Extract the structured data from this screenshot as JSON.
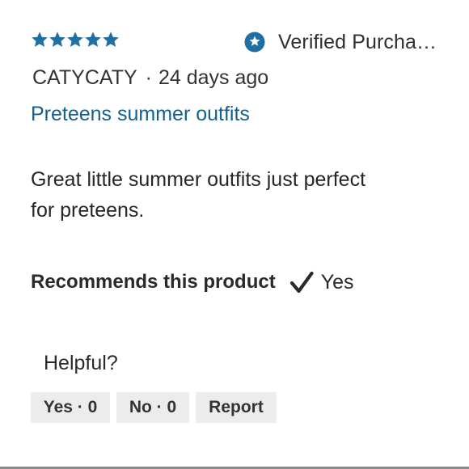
{
  "review": {
    "rating": 5,
    "rating_max": 5,
    "star_color": "#1f6fa3",
    "verified_label": "Verified Purcha…",
    "author": "CATYCATY",
    "separator": "·",
    "age": "24 days ago",
    "title": "Preteens summer outfits",
    "title_color": "#14618f",
    "body_line1": "Great little summer outfits just perfect",
    "body_line2": "for preteens.",
    "recommends_label": "Recommends this product",
    "recommends_value": "Yes"
  },
  "helpful": {
    "prompt": "Helpful?",
    "yes_label": "Yes · 0",
    "no_label": "No · 0",
    "report_label": "Report"
  },
  "icons": {
    "star": "star-icon",
    "verified": "verified-badge-icon",
    "check": "checkmark-icon"
  }
}
